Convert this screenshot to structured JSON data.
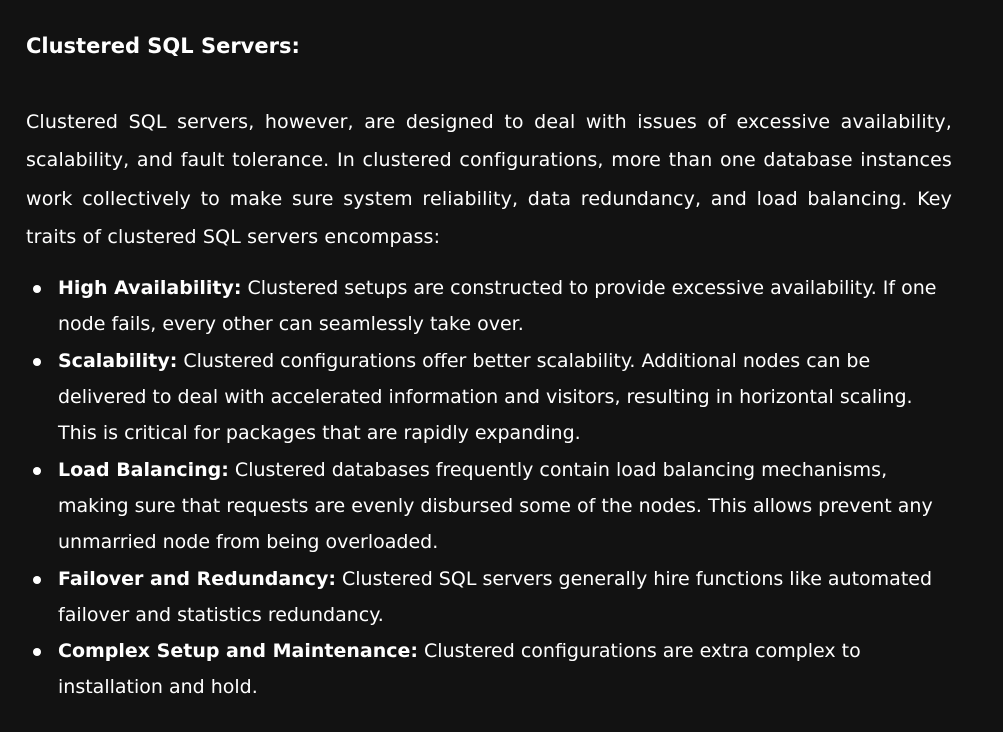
{
  "heading": "Clustered SQL Servers:",
  "intro": "Clustered SQL servers, however, are designed to deal with issues of excessive availability, scalability, and fault tolerance. In clustered configurations, more than one database instances work collectively to make sure system reliability, data redundancy, and load balancing. Key traits of clustered SQL servers encompass:",
  "traits": [
    {
      "term": "High Availability:",
      "text": "Clustered setups are constructed to provide excessive availability. If one node fails, every other can seamlessly take over."
    },
    {
      "term": "Scalability:",
      "text": "Clustered configurations offer better scalability. Additional nodes can be delivered to deal with accelerated information and visitors, resulting in horizontal scaling. This is critical for packages that are rapidly expanding."
    },
    {
      "term": "Load Balancing:",
      "text": "Clustered databases frequently contain load balancing mechanisms, making sure that requests are evenly disbursed some of the nodes. This allows prevent any unmarried node from being overloaded."
    },
    {
      "term": "Failover and Redundancy:",
      "text": "Clustered SQL servers generally hire functions like automated failover and statistics redundancy."
    },
    {
      "term": "Complex Setup and Maintenance:",
      "text": "Clustered configurations are extra complex to installation and hold."
    }
  ]
}
